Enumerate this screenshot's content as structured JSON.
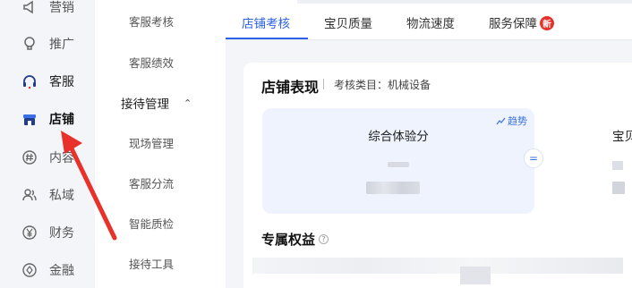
{
  "sidebar": {
    "items": [
      {
        "label": "营销",
        "icon": "megaphone-icon"
      },
      {
        "label": "推广",
        "icon": "bulb-icon"
      },
      {
        "label": "客服",
        "icon": "headset-icon"
      },
      {
        "label": "店铺",
        "icon": "store-icon"
      },
      {
        "label": "内容",
        "icon": "hashtag-icon"
      },
      {
        "label": "私域",
        "icon": "people-icon"
      },
      {
        "label": "财务",
        "icon": "yen-icon"
      },
      {
        "label": "金融",
        "icon": "finance-icon"
      }
    ],
    "active": "店铺"
  },
  "submenu": {
    "items": [
      "客服考核",
      "客服绩效"
    ],
    "group_label": "接待管理",
    "group_items": [
      "现场管理",
      "客服分流",
      "智能质检",
      "接待工具"
    ]
  },
  "tabs": [
    {
      "label": "店铺考核",
      "active": true
    },
    {
      "label": "宝贝质量"
    },
    {
      "label": "物流速度"
    },
    {
      "label": "服务保障",
      "badge": "新"
    }
  ],
  "card": {
    "title": "店铺表现",
    "category": "考核类目：机械设备",
    "metric1_title": "综合体验分",
    "trend_label": "趋势",
    "equal_symbol": "=",
    "metric2_title": "宝贝",
    "perks_title": "专属权益"
  },
  "colors": {
    "accent": "#2d62e8",
    "badge": "#e5322d",
    "arrow": "#e8312a"
  }
}
